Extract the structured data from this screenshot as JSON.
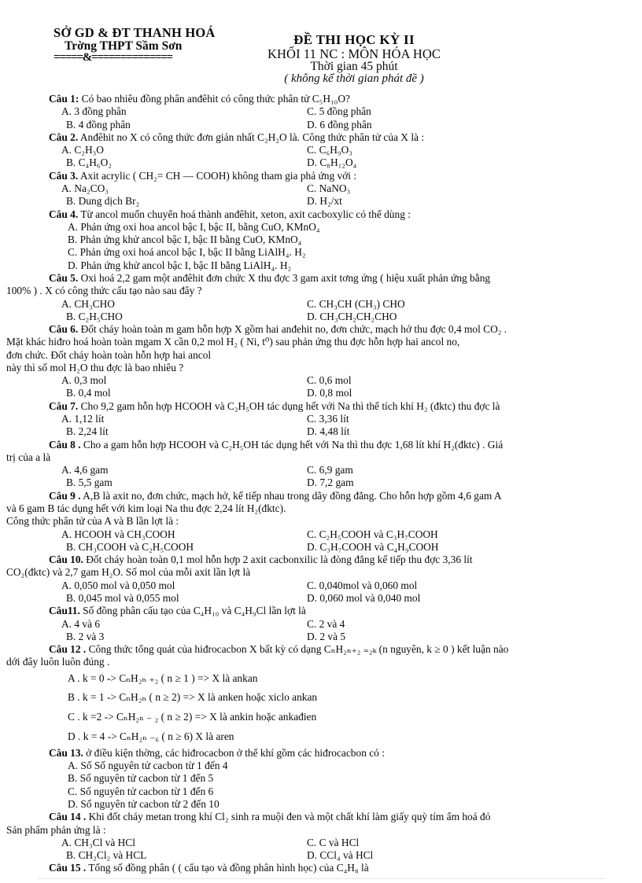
{
  "header": {
    "school_line1": "SỞ GD & ĐT THANH HOÁ",
    "school_line2": "Trờng    THPT Sầm Sơn",
    "school_rule": "=====&==============",
    "exam_title": "ĐỀ THI HỌC KỲ II",
    "exam_subject": "KHỐI 11 NC : MÔN HÓA HỌC",
    "exam_time": "Thời gian 45 phút",
    "exam_note": "( không kể thời gian phát đề )"
  },
  "questions": [
    {
      "id": "cau-1",
      "number": "Câu 1:",
      "stem": "Có bao nhiêu đồng phân anđêhit có công thức phân tử C₅H₁₀O?",
      "layout": "two-column",
      "options": [
        {
          "left": "A. 3 đồng phân",
          "right": "C. 5 đồng phân"
        },
        {
          "left": "B. 4 đồng phân",
          "right": "D. 6 đồng phân"
        }
      ]
    },
    {
      "id": "cau-2",
      "number": "Câu 2.",
      "stem": "Anđêhit no X có công thức đơn giản nhất C₂H₂O là. Công thức phân tử của X là :",
      "layout": "two-column",
      "options": [
        {
          "left": "A. C₂H₃O",
          "right": "C. C₆H₉O₃"
        },
        {
          "left": "B. C₄H₆O₂",
          "right": "D. C₈H₁₂O₄"
        }
      ]
    },
    {
      "id": "cau-3",
      "number": "Câu 3.",
      "stem": "Axit acrylic ( CH₂= CH — COOH) không tham gia phả ứng với :",
      "layout": "two-column",
      "options": [
        {
          "left": "A. Na₂CO₃",
          "right": "C. NaNO₃"
        },
        {
          "left": "B. Dung dịch Br₂",
          "right": "D. H₂/xt"
        }
      ]
    },
    {
      "id": "cau-4",
      "number": "Câu 4.",
      "stem": "Từ ancol muốn chuyển hoá thành anđêhit, xeton, axit cacboxylic có thể dùng :",
      "layout": "stacked",
      "options": [
        "A.   Phản ứng oxi hoa ancol bậc I, bậc II, bằng CuO, KMnO₄",
        "B.   Phản ứng khử ancol bậc I, bậc II bằng CuO, KMnO₄",
        "C.   Phản ứng oxi hoá ancol bậc I, bậc II bằng LiAlH₄. H₂",
        "D.   Phản ứng khử ancol bậc I, bậc II bằng LiAlH₄. H₂"
      ]
    },
    {
      "id": "cau-5",
      "number": "Câu 5.",
      "stem": "Oxi hoá 2,2 gam một anđêhit đơn chức X thu đợc   3 gam axit tơng   ứng ( hiệu xuất phản ứng bằng",
      "stem_cont": [
        "100% ) . X có công thức cấu tạo nào sau đây ?"
      ],
      "layout": "two-column",
      "options": [
        {
          "left": "A. CH₃CHO",
          "right": "C. CH₃CH (CH₃) CHO"
        },
        {
          "left": "B. C₂H₅CHO",
          "right": "D. CH₃CH₂CH₂CHO"
        }
      ]
    },
    {
      "id": "cau-6",
      "number": "Câu 6.",
      "stem": "Đốt cháy hoàn toàn m gam hỗn hợp X gồm hai anđehit no, đơn chức, mạch hở thu đợc   0,4 mol CO₂ .",
      "stem_cont": [
        "Mặt khác hiđro hoá hoàn toàn mgam X cần 0,2 mol H₂ ( Ni, t⁰) sau phản ứng thu đợc   hỗn hợp hai ancol no,",
        "đơn chức. Đốt cháy hoàn toàn hỗn hợp hai ancol",
        "này thì số mol H₂O thu đợc   là bao nhiêu ?"
      ],
      "layout": "two-column",
      "options": [
        {
          "left": "A. 0,3 mol",
          "right": "C. 0,6 mol"
        },
        {
          "left": "B. 0,4 mol",
          "right": "D. 0,8 mol"
        }
      ]
    },
    {
      "id": "cau-7",
      "number": "Câu 7.",
      "stem": "Cho 9,2 gam hỗn hợp HCOOH và C₂H₅OH tác dụng hết với Na thì thể tích khí H₂ (đktc) thu đợc   là",
      "layout": "two-column",
      "options": [
        {
          "left": "A. 1,12 lít",
          "right": "C. 3,36 lít"
        },
        {
          "left": "B. 2,24 lít",
          "right": "D. 4,48 lít"
        }
      ]
    },
    {
      "id": "cau-8",
      "number": "Câu 8 .",
      "stem": "Cho a gam hỗn hợp HCOOH và C₂H₅OH tác dụng hết với Na thì thu đợc   1,68 lít khí H₂(đktc) . Giá",
      "stem_cont": [
        "trị của a là"
      ],
      "layout": "two-column",
      "options": [
        {
          "left": "A. 4,6 gam",
          "right": "C. 6,9 gam"
        },
        {
          "left": "B. 5,5 gam",
          "right": "D. 7,2 gam"
        }
      ]
    },
    {
      "id": "cau-9",
      "number": "Câu 9 .",
      "stem": "A,B là axit no, đơn chức, mạch hở, kế tiếp nhau trong dãy đồng đẳng. Cho hỗn hợp gồm 4,6 gam A",
      "stem_cont": [
        "và 6 gam B tác dụng hết với kim loại Na thu đợc   2,24 lít H₂(đktc).",
        "Công thức phân tử của A và B lần lợt   là :"
      ],
      "layout": "two-column",
      "options": [
        {
          "left": "A.  HCOOH và CH₃COOH",
          "right": "C. C₂H₅COOH và C₃H₇COOH"
        },
        {
          "left": "B. CH₃COOH và C₂H₅COOH",
          "right": "D. C₃H₇COOH và C₄H₉COOH"
        }
      ]
    },
    {
      "id": "cau-10",
      "number": "Câu 10.",
      "stem": "Đốt cháy hoàn toàn 0,1 mol hỗn hợp 2 axit cacbonxilic là đòng đẳng kế tiếp thu đợc   3,36 lít",
      "stem_cont": [
        "CO₂(đktc) và 2,7 gam H₂O. Số mol của mỗi axit lần lợt   là"
      ],
      "layout": "two-column",
      "options": [
        {
          "left": "A. 0,050 mol và 0,050 mol",
          "right": "C. 0,040mol và 0,060 mol"
        },
        {
          "left": "B. 0,045 mol và 0,055 mol",
          "right": "D. 0,060 mol và 0,040 mol"
        }
      ]
    },
    {
      "id": "cau-11",
      "number": "Câu11.",
      "stem": "Số đồng phân cấu tạo của C₄H₁₀ và C₄H₉Cl lần lợt   là",
      "layout": "two-column",
      "options": [
        {
          "left": "A. 4 và 6",
          "right": "C. 2 và 4"
        },
        {
          "left": "B. 2 và 3",
          "right": "D. 2 và 5"
        }
      ]
    },
    {
      "id": "cau-12",
      "number": "Câu 12 .",
      "stem": "Công thức tổng quát của hiđrocacbon X bất kỳ có dạng CₙH₂ₙ₊₂ ₌₂ₖ (n nguyên, k ≥ 0 ) kết luận nào",
      "stem_cont": [
        "dới   đây luôn luôn đúng ."
      ],
      "layout": "stacked-wide",
      "options": [
        "A . k = 0   -> CₙH₂ₙ ₊₂ ( n ≥ 1 )  => X là ankan",
        "B . k = 1   -> CₙH₂ₙ ( n ≥ 2)       => X là anken hoặc xiclo ankan",
        "C . k =2    -> CₙH₂ₙ ₋ ₂ ( n ≥ 2)   => X là ankin hoặc ankađien",
        "D . k = 4   -> CₙH₂ₙ ₋₆            ( n ≥ 6) X là aren"
      ]
    },
    {
      "id": "cau-13",
      "number": "Câu 13.",
      "stem": "ở điều kiện thờng,   các hiđrocacbon ở thể khí gồm các hiđrocacbon có :",
      "layout": "stacked",
      "options": [
        "A.    Số Số nguyên tử cacbon từ 1 đến 4",
        "B.    Số nguyên tử cacbon từ 1 đến 5",
        "C. Số nguyên  tử cacbon từ 1 đến 6",
        "D. Số nguyên tử cacbon từ  2 đến 10"
      ]
    },
    {
      "id": "cau-14",
      "number": "Câu 14 .",
      "stem": "Khi đốt cháy metan trong khí Cl₂ sinh ra muội đen và một chất khí làm giấy quỳ tím ẩm hoá đỏ",
      "stem_cont": [
        "Sản phẩm phản ứng là :"
      ],
      "layout": "two-column",
      "options": [
        {
          "left": "A. CH₃Cl   và  HCl",
          "right": "C.   C và HCl"
        },
        {
          "left": "B. CH₂Cl₂ và HCL",
          "right": "D. CCl₄ và HCl"
        }
      ]
    },
    {
      "id": "cau-15",
      "number": "Câu 15 .",
      "stem": "Tổng số đồng phân ( ( cấu tạo và đồng phân hình học) của C₄H₈ là",
      "layout": "none",
      "options": []
    }
  ]
}
